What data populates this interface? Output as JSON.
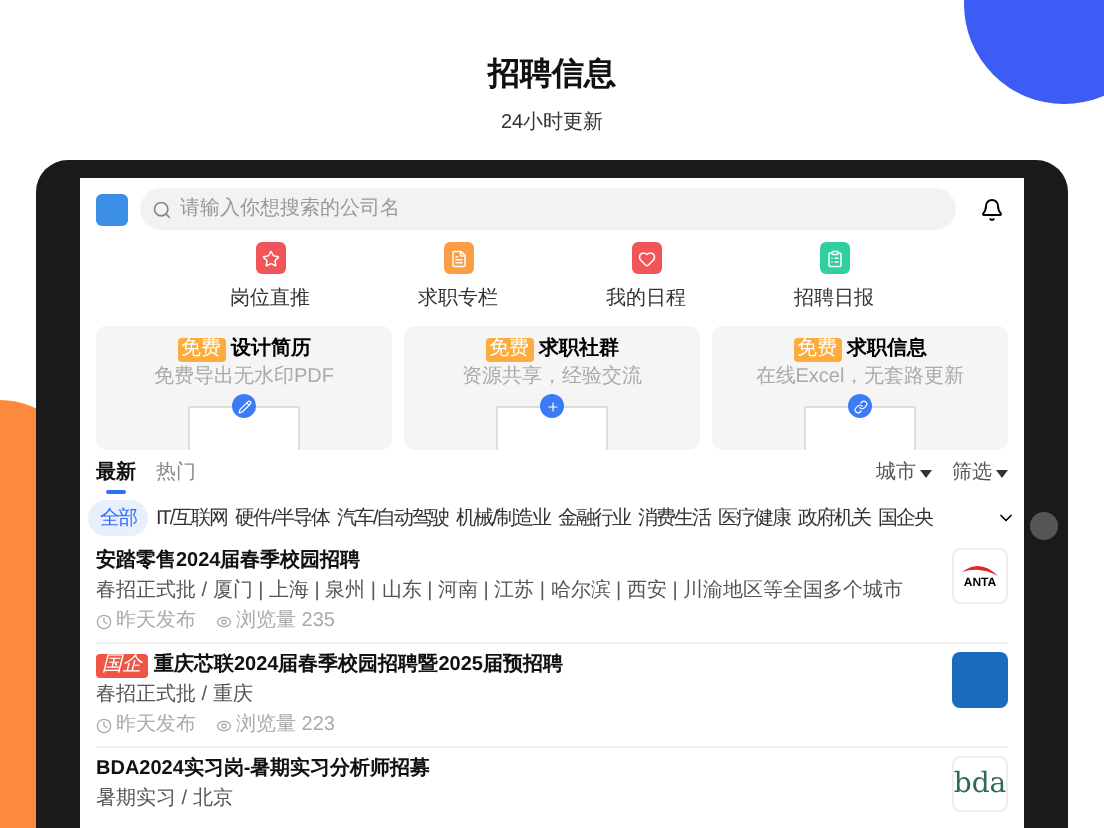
{
  "header": {
    "title": "招聘信息",
    "subtitle": "24小时更新"
  },
  "search": {
    "placeholder": "请输入你想搜索的公司名"
  },
  "shortcuts": [
    {
      "label": "岗位直推",
      "kind": "bookmark"
    },
    {
      "label": "求职专栏",
      "kind": "document"
    },
    {
      "label": "我的日程",
      "kind": "heart"
    },
    {
      "label": "招聘日报",
      "kind": "report"
    }
  ],
  "promos": [
    {
      "badge": "免费",
      "title": "设计简历",
      "subtitle": "免费导出无水印PDF",
      "kind": "edit"
    },
    {
      "badge": "免费",
      "title": "求职社群",
      "subtitle": "资源共享，经验交流",
      "kind": "plus"
    },
    {
      "badge": "免费",
      "title": "求职信息",
      "subtitle": "在线Excel，无套路更新",
      "kind": "link"
    }
  ],
  "tabs": [
    {
      "label": "最新",
      "selected": true
    },
    {
      "label": "热门",
      "selected": false
    }
  ],
  "filters": [
    "城市",
    "筛选"
  ],
  "categories": [
    {
      "label": "全部",
      "selected": true
    },
    {
      "label": "IT/互联网",
      "selected": false
    },
    {
      "label": "硬件/半导体",
      "selected": false
    },
    {
      "label": "汽车/自动驾驶",
      "selected": false
    },
    {
      "label": "机械/制造业",
      "selected": false
    },
    {
      "label": "金融行业",
      "selected": false
    },
    {
      "label": "消费生活",
      "selected": false
    },
    {
      "label": "医疗健康",
      "selected": false
    },
    {
      "label": "政府机关",
      "selected": false
    },
    {
      "label": "国企央",
      "selected": false
    }
  ],
  "jobs": [
    {
      "title": "安踏零售2024届春季校园招聘",
      "details": "春招正式批 / 厦门 | 上海 | 泉州 | 山东 | 河南 | 江苏 | 哈尔滨 | 西安 | 川渝地区等全国多个城市",
      "posted": "昨天发布",
      "views": "浏览量 235",
      "logo": {
        "kind": "swoosh",
        "text": "ANTA"
      }
    },
    {
      "title": "重庆芯联2024届春季校园招聘暨2025届预招聘",
      "tag": "国企",
      "details": "春招正式批 / 重庆",
      "posted": "昨天发布",
      "views": "浏览量 223",
      "logo": {
        "kind": "blue"
      }
    },
    {
      "title": "BDA2024实习岗-暑期实习分析师招募",
      "details": "暑期实习 / 北京",
      "logo": {
        "kind": "text",
        "text": "bda"
      }
    }
  ]
}
